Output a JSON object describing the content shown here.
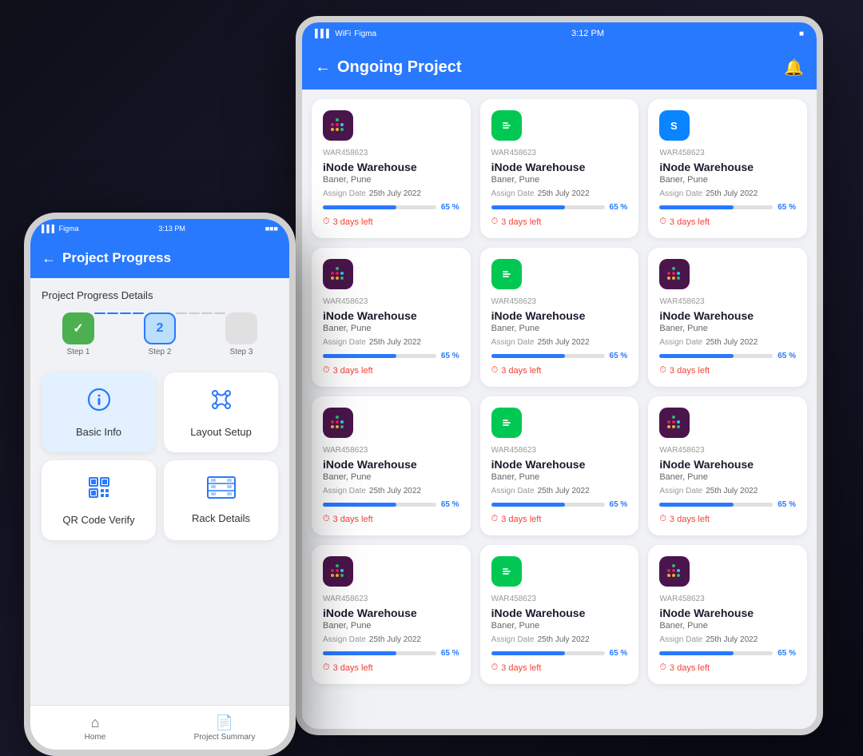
{
  "tablet": {
    "statusBar": {
      "signal": "Figma",
      "time": "3:12 PM",
      "battery": "■"
    },
    "header": {
      "backLabel": "←",
      "title": "Ongoing Project",
      "bellLabel": "🔔"
    },
    "cards": [
      {
        "id": "WAR458623",
        "title": "iNode Warehouse",
        "location": "Baner, Pune",
        "assignLabel": "Assign Date",
        "assignDate": "25th July 2022",
        "progress": 65,
        "progressLabel": "65 %",
        "daysLeft": "3 days left",
        "iconType": "slack"
      },
      {
        "id": "WAR458623",
        "title": "iNode Warehouse",
        "location": "Baner, Pune",
        "assignLabel": "Assign Date",
        "assignDate": "25th July 2022",
        "progress": 65,
        "progressLabel": "65 %",
        "daysLeft": "3 days left",
        "iconType": "chat"
      },
      {
        "id": "WAR458623",
        "title": "iNode Warehouse",
        "location": "Baner, Pune",
        "assignLabel": "Assign Date",
        "assignDate": "25th July 2022",
        "progress": 65,
        "progressLabel": "65 %",
        "daysLeft": "3 days left",
        "iconType": "shazam"
      },
      {
        "id": "WAR458623",
        "title": "iNode Warehouse",
        "location": "Baner, Pune",
        "assignLabel": "Assign Date",
        "assignDate": "25th July 2022",
        "progress": 65,
        "progressLabel": "65 %",
        "daysLeft": "3 days left",
        "iconType": "slack"
      },
      {
        "id": "WAR458623",
        "title": "iNode Warehouse",
        "location": "Baner, Pune",
        "assignLabel": "Assign Date",
        "assignDate": "25th July 2022",
        "progress": 65,
        "progressLabel": "65 %",
        "daysLeft": "3 days left",
        "iconType": "chat"
      },
      {
        "id": "WAR458623",
        "title": "iNode Warehouse",
        "location": "Baner, Pune",
        "assignLabel": "Assign Date",
        "assignDate": "25th July 2022",
        "progress": 65,
        "progressLabel": "65 %",
        "daysLeft": "3 days left",
        "iconType": "slack"
      },
      {
        "id": "WAR458623",
        "title": "iNode Warehouse",
        "location": "Baner, Pune",
        "assignLabel": "Assign Date",
        "assignDate": "25th July 2022",
        "progress": 65,
        "progressLabel": "65 %",
        "daysLeft": "3 days left",
        "iconType": "slack"
      },
      {
        "id": "WAR458623",
        "title": "iNode Warehouse",
        "location": "Baner, Pune",
        "assignLabel": "Assign Date",
        "assignDate": "25th July 2022",
        "progress": 65,
        "progressLabel": "65 %",
        "daysLeft": "3 days left",
        "iconType": "chat"
      },
      {
        "id": "WAR458623",
        "title": "iNode Warehouse",
        "location": "Baner, Pune",
        "assignLabel": "Assign Date",
        "assignDate": "25th July 2022",
        "progress": 65,
        "progressLabel": "65 %",
        "daysLeft": "3 days left",
        "iconType": "slack"
      },
      {
        "id": "WAR458623",
        "title": "iNode Warehouse",
        "location": "Baner, Pune",
        "assignLabel": "Assign Date",
        "assignDate": "25th July 2022",
        "progress": 65,
        "progressLabel": "65 %",
        "daysLeft": "3 days left",
        "iconType": "slack"
      },
      {
        "id": "WAR458623",
        "title": "iNode Warehouse",
        "location": "Baner, Pune",
        "assignLabel": "Assign Date",
        "assignDate": "25th July 2022",
        "progress": 65,
        "progressLabel": "65 %",
        "daysLeft": "3 days left",
        "iconType": "chat"
      },
      {
        "id": "WAR458623",
        "title": "iNode Warehouse",
        "location": "Baner, Pune",
        "assignLabel": "Assign Date",
        "assignDate": "25th July 2022",
        "progress": 65,
        "progressLabel": "65 %",
        "daysLeft": "3 days left",
        "iconType": "slack"
      }
    ]
  },
  "phone": {
    "statusBar": {
      "signal": "Figma",
      "time": "3:13 PM",
      "battery": "■"
    },
    "header": {
      "backLabel": "←",
      "title": "Project Progress"
    },
    "sectionTitle": "Project Progress Details",
    "steps": [
      {
        "label": "Step 1",
        "state": "done",
        "display": "✓"
      },
      {
        "label": "Step 2",
        "state": "active",
        "display": "2"
      },
      {
        "label": "Step 3",
        "state": "inactive",
        "display": ""
      }
    ],
    "menuItems": [
      {
        "label": "Basic Info",
        "iconType": "info",
        "selected": true
      },
      {
        "label": "Layout Setup",
        "iconType": "layout",
        "selected": false
      },
      {
        "label": "QR Code Verify",
        "iconType": "qr",
        "selected": false
      },
      {
        "label": "Rack Details",
        "iconType": "rack",
        "selected": false
      }
    ],
    "nav": [
      {
        "label": "Home",
        "iconType": "home"
      },
      {
        "label": "Project Summary",
        "iconType": "doc"
      }
    ]
  }
}
